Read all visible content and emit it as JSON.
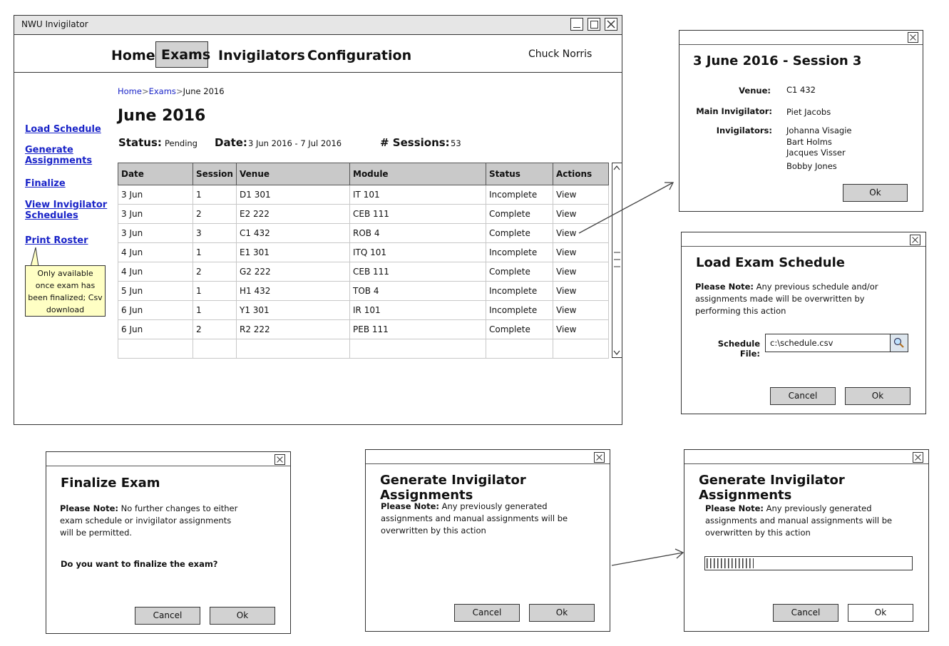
{
  "main_window": {
    "title": "NWU Invigilator",
    "nav": [
      "Home",
      "Exams",
      "Invigilators",
      "Configuration"
    ],
    "active_nav": "Exams",
    "user": "Chuck Norris",
    "breadcrumb": [
      "Home",
      "Exams",
      "June 2016"
    ],
    "breadcrumb_sep": ">",
    "page_title": "June 2016",
    "status_label": "Status:",
    "status_value": "Pending",
    "date_label": "Date:",
    "date_value": "3 Jun 2016 - 7 Jul 2016",
    "sessions_label": "# Sessions:",
    "sessions_value": "53",
    "sidebar": [
      "Load Schedule",
      "Generate Assignments",
      "Finalize",
      "View Invigilator Schedules",
      "Print Roster"
    ],
    "tooltip": "Only available once exam has been finalized; Csv download",
    "table": {
      "columns": [
        "Date",
        "Session",
        "Venue",
        "Module",
        "Status",
        "Actions"
      ],
      "rows": [
        [
          "3 Jun",
          "1",
          "D1 301",
          "IT 101",
          "Incomplete",
          "View"
        ],
        [
          "3 Jun",
          "2",
          "E2 222",
          "CEB 111",
          "Complete",
          "View"
        ],
        [
          "3 Jun",
          "3",
          "C1 432",
          "ROB 4",
          "Complete",
          "View"
        ],
        [
          "4 Jun",
          "1",
          "E1 301",
          "ITQ 101",
          "Incomplete",
          "View"
        ],
        [
          "4 Jun",
          "2",
          "G2 222",
          "CEB 111",
          "Complete",
          "View"
        ],
        [
          "5 Jun",
          "1",
          "H1 432",
          "TOB 4",
          "Incomplete",
          "View"
        ],
        [
          "6 Jun",
          "1",
          "Y1 301",
          "IR 101",
          "Incomplete",
          "View"
        ],
        [
          "6 Jun",
          "2",
          "R2 222",
          "PEB 111",
          "Complete",
          "View"
        ]
      ]
    }
  },
  "session_dialog": {
    "title": "3 June 2016 - Session 3",
    "venue_label": "Venue:",
    "venue": "C1 432",
    "main_label": "Main Invigilator:",
    "main_invigilator": "Piet Jacobs",
    "invigilators_label": "Invigilators:",
    "invigilators": [
      "Johanna Visagie",
      "Bart Holms",
      "Jacques Visser",
      "Bobby Jones"
    ],
    "ok": "Ok"
  },
  "load_dialog": {
    "title": "Load Exam Schedule",
    "note_label": "Please Note:",
    "note_lines": [
      " Any previous schedule and/or",
      "assignments made will be overwritten by",
      "performing this action"
    ],
    "file_label": "Schedule File:",
    "file_value": "c:\\schedule.csv",
    "cancel": "Cancel",
    "ok": "Ok"
  },
  "finalize_dialog": {
    "title": "Finalize Exam",
    "note_label": "Please Note:",
    "note_lines": [
      " No further changes to either",
      "exam schedule or invigilator assignments",
      "will be permitted."
    ],
    "question": "Do you want to finalize the exam?",
    "cancel": "Cancel",
    "ok": "Ok"
  },
  "generate_dialog": {
    "title": "Generate Invigilator Assignments",
    "note_label": "Please Note:",
    "note_lines": [
      " Any previously generated",
      "assignments and manual assignments will be",
      "overwritten by this action"
    ],
    "cancel": "Cancel",
    "ok": "Ok"
  },
  "generate_progress_dialog": {
    "title": "Generate Invigilator Assignments",
    "note_label": "Please Note:",
    "note_lines": [
      " Any previously generated",
      "assignments and manual assignments will be",
      "overwritten by this action"
    ],
    "progress": 0.23,
    "cancel": "Cancel",
    "ok": "Ok"
  }
}
